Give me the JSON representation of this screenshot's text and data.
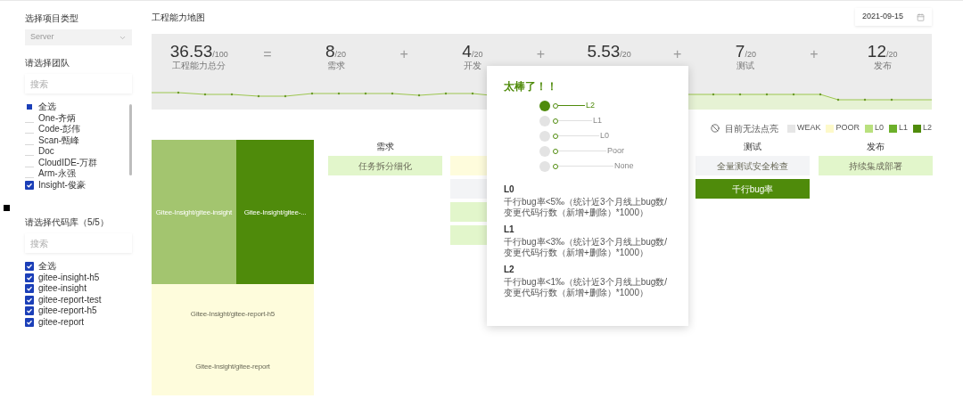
{
  "sidebar": {
    "project_type": {
      "label": "选择项目类型",
      "value": "Server"
    },
    "team": {
      "label": "请选择团队",
      "search_placeholder": "搜索",
      "items": [
        {
          "label": "全选",
          "checked": false,
          "indeterminate": true
        },
        {
          "label": "One-齐炳",
          "checked": false,
          "indeterminate": false
        },
        {
          "label": "Code-彭伟",
          "checked": false,
          "indeterminate": false
        },
        {
          "label": "Scan-甄峰",
          "checked": false,
          "indeterminate": false
        },
        {
          "label": "Doc",
          "checked": false,
          "indeterminate": false
        },
        {
          "label": "CloudIDE-万群",
          "checked": false,
          "indeterminate": false
        },
        {
          "label": "Arm-永强",
          "checked": false,
          "indeterminate": false
        },
        {
          "label": "Insight-俊豪",
          "checked": true,
          "indeterminate": false
        }
      ]
    },
    "repos": {
      "label": "请选择代码库（5/5）",
      "search_placeholder": "搜索",
      "items": [
        {
          "label": "全选",
          "checked": true
        },
        {
          "label": "gitee-insight-h5",
          "checked": true
        },
        {
          "label": "gitee-insight",
          "checked": true
        },
        {
          "label": "gitee-report-test",
          "checked": true
        },
        {
          "label": "gitee-report-h5",
          "checked": true
        },
        {
          "label": "gitee-report",
          "checked": true
        }
      ]
    }
  },
  "header": {
    "title": "工程能力地图",
    "date": "2021-09-15"
  },
  "scores": [
    {
      "kind": "score",
      "value": "36.53",
      "max": "/100",
      "label": "工程能力总分"
    },
    {
      "kind": "operator",
      "symbol": "="
    },
    {
      "kind": "score",
      "value": "8",
      "max": "/20",
      "label": "需求"
    },
    {
      "kind": "operator",
      "symbol": "+"
    },
    {
      "kind": "score",
      "value": "4",
      "max": "/20",
      "label": "开发"
    },
    {
      "kind": "operator",
      "symbol": "+"
    },
    {
      "kind": "score",
      "value": "5.53",
      "max": "/20"
    },
    {
      "kind": "operator",
      "symbol": "+"
    },
    {
      "kind": "score",
      "value": "7",
      "max": "/20",
      "label": "测试"
    },
    {
      "kind": "operator",
      "symbol": "+"
    },
    {
      "kind": "score",
      "value": "12",
      "max": "/20",
      "label": "发布"
    }
  ],
  "legend": {
    "unavailable": "目前无法点亮",
    "grades": [
      {
        "label": "WEAK",
        "color": "#e6e6e6"
      },
      {
        "label": "POOR",
        "color": "#fdf9c9"
      },
      {
        "label": "L0",
        "color": "#b9e07e"
      },
      {
        "label": "L1",
        "color": "#6cb02a"
      },
      {
        "label": "L2",
        "color": "#4f8b0b"
      }
    ]
  },
  "treemap": [
    {
      "label": "Gitee-Insight/gitee-insight",
      "color": "#a3c56f"
    },
    {
      "label": "Gitee-Insight/gitee-...",
      "color": "#4f8b0b"
    },
    {
      "label": "Gitee-Insight/gitee-report-h5",
      "color": "#fefcdc"
    },
    {
      "label": "Gitee-Insight/gitee-report",
      "color": "#fefcdc"
    }
  ],
  "columns_left": [
    {
      "title": "需求",
      "cells": [
        {
          "label": "任务拆分细化",
          "color": "#e2f6cb"
        }
      ]
    },
    {
      "cells": [
        {
          "color": "#fefcdc"
        },
        {
          "color": "#f3f4f6"
        },
        {
          "color": "#e2f6cb"
        },
        {
          "color": "#e2f6cb"
        }
      ]
    }
  ],
  "columns_right": [
    {
      "title": "测试",
      "cells": [
        {
          "label": "全量测试安全检查",
          "color": "#f3f4f6"
        },
        {
          "label": "千行bug率",
          "color": "#4f8b0b"
        }
      ]
    },
    {
      "title": "发布",
      "cells": [
        {
          "label": "持续集成部署",
          "color": "#e2f6cb"
        }
      ]
    }
  ],
  "popover": {
    "title": "太棒了！！",
    "ladder": [
      {
        "label": "L2",
        "selected": true
      },
      {
        "label": "L1",
        "selected": false
      },
      {
        "label": "L0",
        "selected": false
      },
      {
        "label": "Poor",
        "selected": false
      },
      {
        "label": "None",
        "selected": false
      }
    ],
    "levels": [
      {
        "name": "L0",
        "description": "千行bug率<5‰（统计近3个月线上bug数/变更代码行数（新增+删除）*1000）"
      },
      {
        "name": "L1",
        "description": "千行bug率<3‰（统计近3个月线上bug数/变更代码行数（新增+删除）*1000）"
      },
      {
        "name": "L2",
        "description": "千行bug率<1‰（统计近3个月线上bug数/变更代码行数（新增+删除）*1000）"
      }
    ]
  }
}
